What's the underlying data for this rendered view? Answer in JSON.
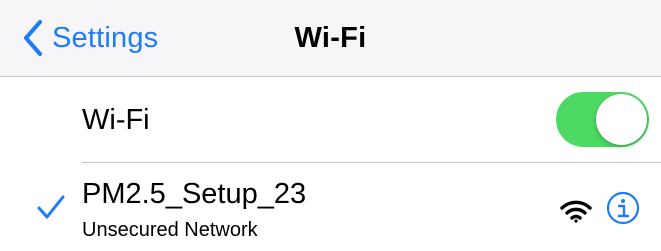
{
  "navbar": {
    "back_label": "Settings",
    "title": "Wi-Fi",
    "back_icon": "chevron-left-icon"
  },
  "wifi_toggle": {
    "label": "Wi-Fi",
    "on": true
  },
  "current_network": {
    "name": "PM2.5_Setup_23",
    "subtitle": "Unsecured Network",
    "connected": true,
    "icons": [
      "checkmark-icon",
      "wifi-signal-icon",
      "info-icon"
    ]
  },
  "colors": {
    "accent": "#1f7bf6",
    "toggle_on": "#4cd964",
    "navbar_bg": "#f6f6f8",
    "separator": "#c8c7cc"
  }
}
